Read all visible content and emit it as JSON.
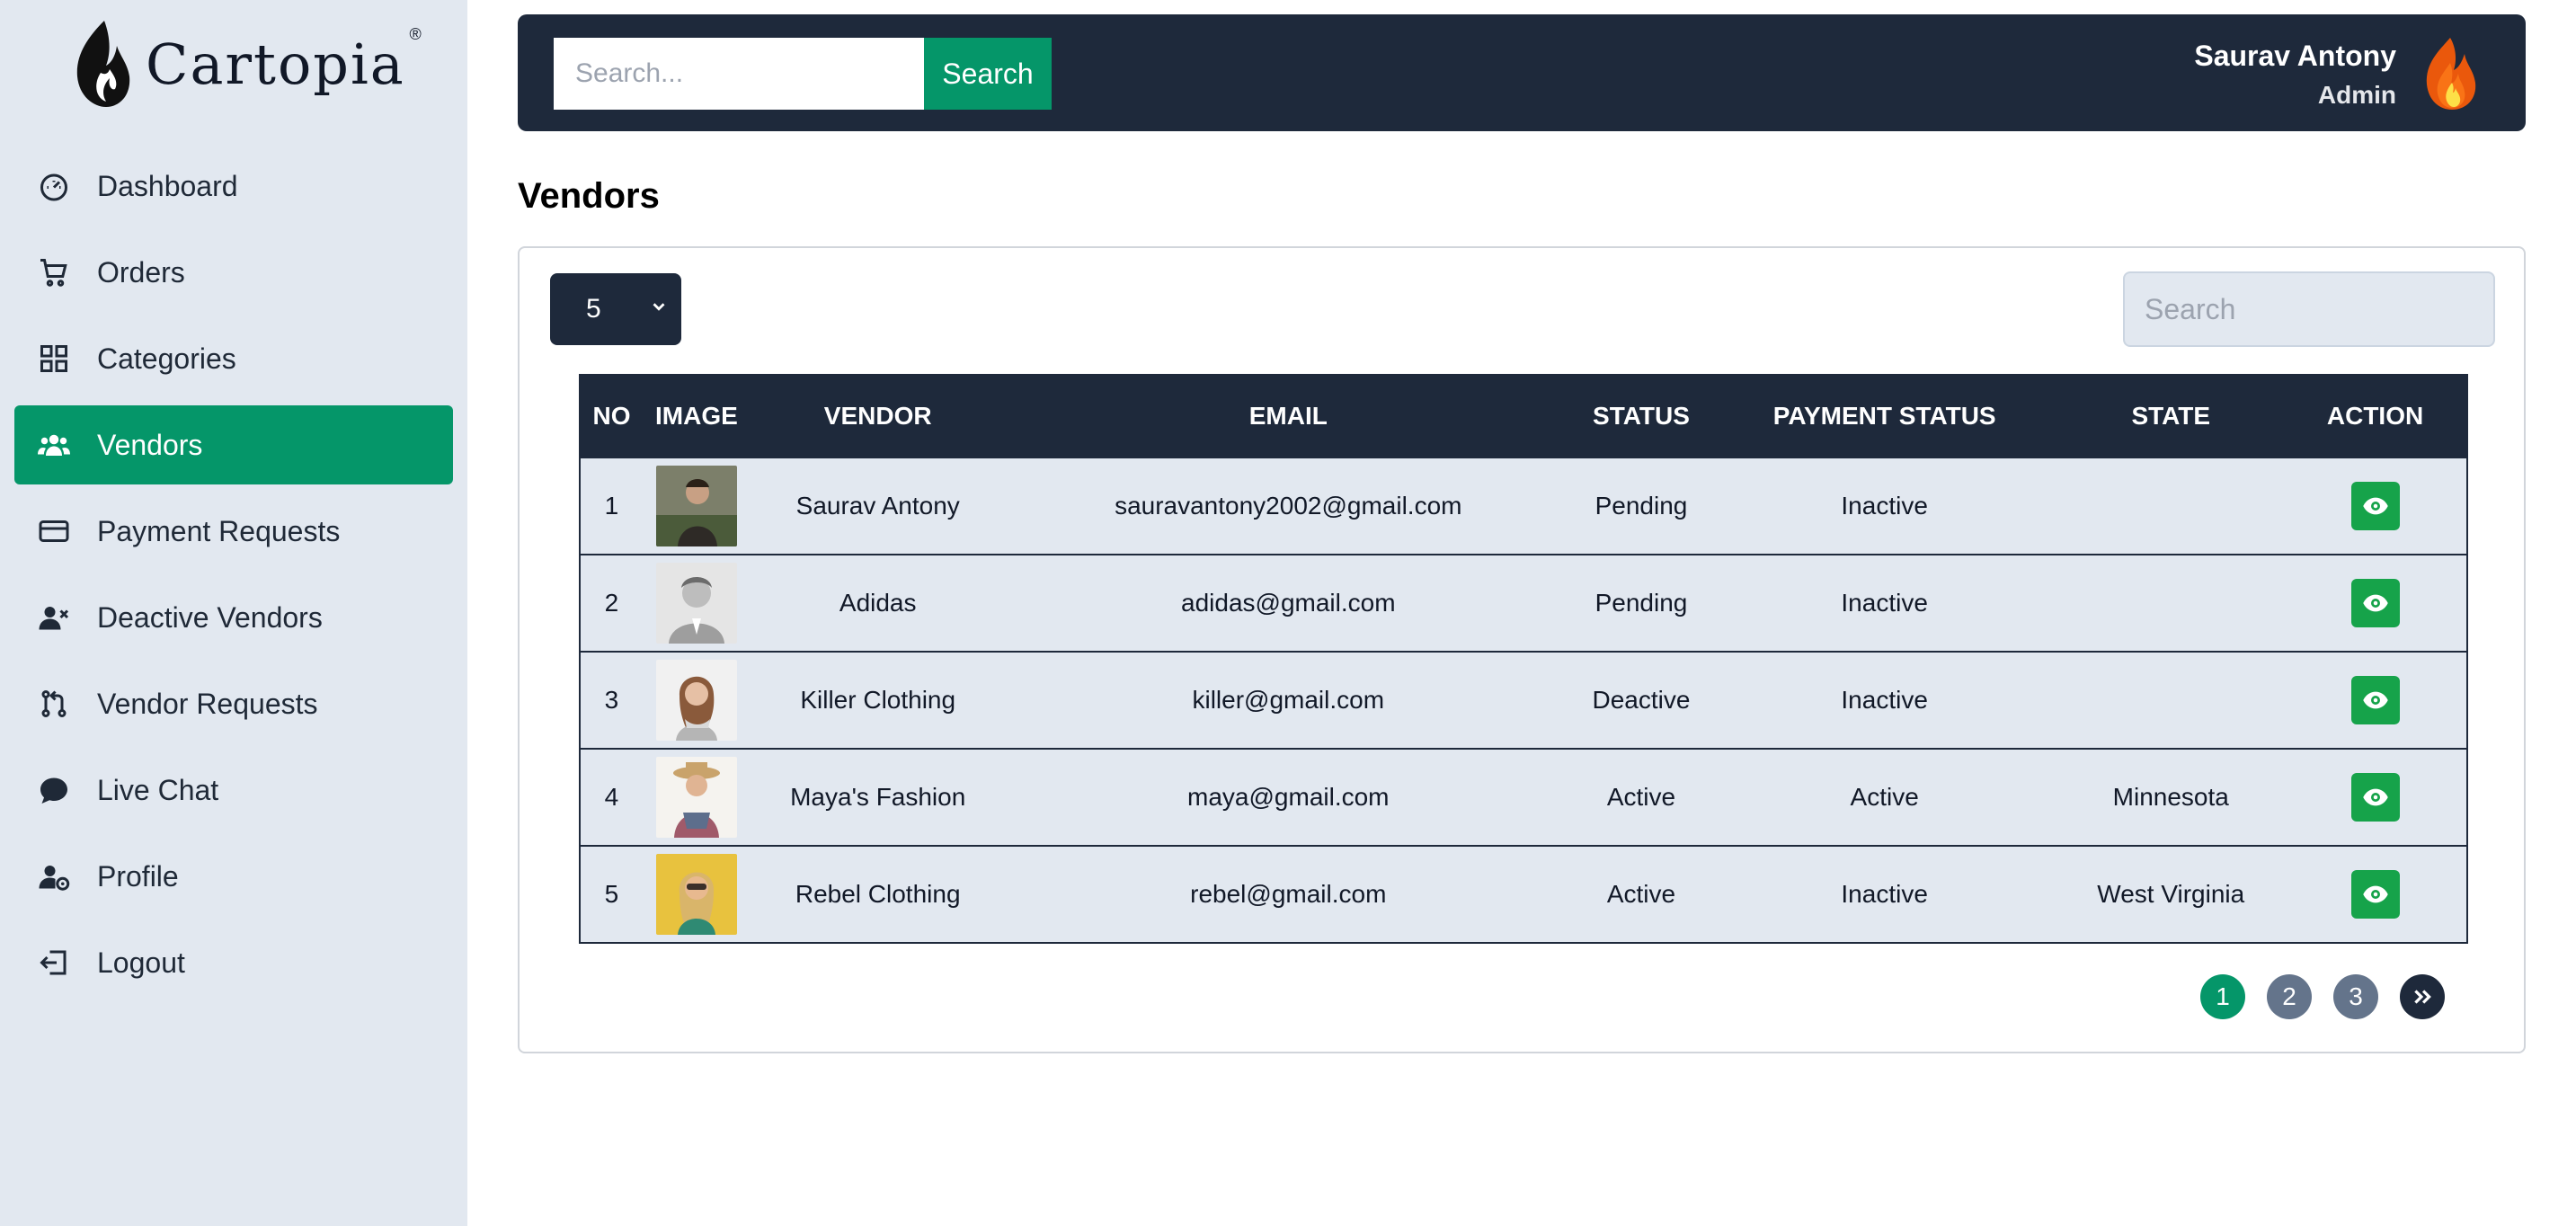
{
  "app": {
    "brand": "Cartopia",
    "registered": "®"
  },
  "sidebar": {
    "items": [
      {
        "label": "Dashboard",
        "icon": "dashboard-icon",
        "active": false
      },
      {
        "label": "Orders",
        "icon": "cart-icon",
        "active": false
      },
      {
        "label": "Categories",
        "icon": "grid-icon",
        "active": false
      },
      {
        "label": "Vendors",
        "icon": "users-icon",
        "active": true
      },
      {
        "label": "Payment Requests",
        "icon": "credit-card-icon",
        "active": false
      },
      {
        "label": "Deactive Vendors",
        "icon": "user-x-icon",
        "active": false
      },
      {
        "label": "Vendor Requests",
        "icon": "git-pull-icon",
        "active": false
      },
      {
        "label": "Live Chat",
        "icon": "chat-icon",
        "active": false
      },
      {
        "label": "Profile",
        "icon": "user-gear-icon",
        "active": false
      },
      {
        "label": "Logout",
        "icon": "logout-icon",
        "active": false
      }
    ]
  },
  "header": {
    "search_placeholder": "Search...",
    "search_button": "Search",
    "user_name": "Saurav Antony",
    "user_role": "Admin"
  },
  "page": {
    "title": "Vendors"
  },
  "table_controls": {
    "page_size": "5",
    "search_placeholder": "Search"
  },
  "table": {
    "columns": [
      "NO",
      "IMAGE",
      "VENDOR",
      "EMAIL",
      "STATUS",
      "PAYMENT STATUS",
      "STATE",
      "ACTION"
    ],
    "rows": [
      {
        "no": "1",
        "vendor": "Saurav Antony",
        "email": "sauravantony2002@gmail.com",
        "status": "Pending",
        "payment_status": "Inactive",
        "state": ""
      },
      {
        "no": "2",
        "vendor": "Adidas",
        "email": "adidas@gmail.com",
        "status": "Pending",
        "payment_status": "Inactive",
        "state": ""
      },
      {
        "no": "3",
        "vendor": "Killer Clothing",
        "email": "killer@gmail.com",
        "status": "Deactive",
        "payment_status": "Inactive",
        "state": ""
      },
      {
        "no": "4",
        "vendor": "Maya's Fashion",
        "email": "maya@gmail.com",
        "status": "Active",
        "payment_status": "Active",
        "state": "Minnesota"
      },
      {
        "no": "5",
        "vendor": "Rebel Clothing",
        "email": "rebel@gmail.com",
        "status": "Active",
        "payment_status": "Inactive",
        "state": "West Virginia"
      }
    ]
  },
  "pagination": {
    "pages": [
      "1",
      "2",
      "3"
    ],
    "current": "1",
    "next_label": "»"
  },
  "colors": {
    "accent": "#059669",
    "dark": "#1e293b",
    "sidebar_bg": "#e2e8f0",
    "view_button": "#16a34a"
  }
}
